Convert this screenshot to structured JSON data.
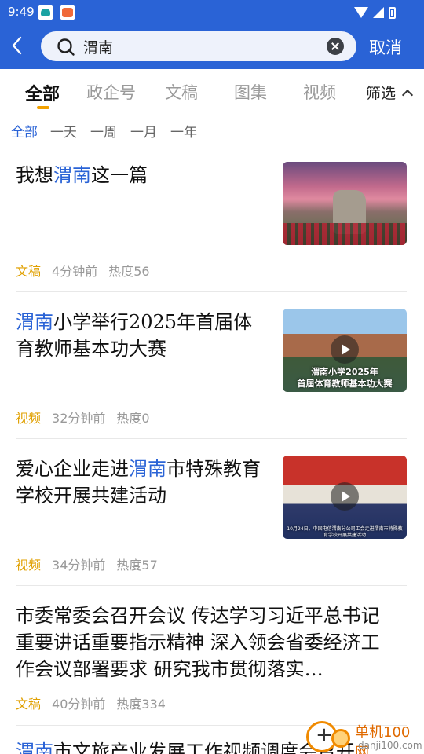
{
  "status_bar": {
    "time": "9:49"
  },
  "search": {
    "query": "渭南",
    "cancel_label": "取消"
  },
  "tabs": [
    {
      "label": "全部",
      "active": true
    },
    {
      "label": "政企号"
    },
    {
      "label": "文稿"
    },
    {
      "label": "图集"
    },
    {
      "label": "视频"
    }
  ],
  "filter": {
    "label": "筛选"
  },
  "time_filters": [
    {
      "label": "全部",
      "active": true
    },
    {
      "label": "一天"
    },
    {
      "label": "一周"
    },
    {
      "label": "一月"
    },
    {
      "label": "一年"
    }
  ],
  "results": [
    {
      "title_pre": "我想",
      "title_hl": "渭南",
      "title_post": "这一篇",
      "category": "文稿",
      "time": "4分钟前",
      "heat": "热度56",
      "thumbnail": "landscape-photo"
    },
    {
      "title_pre": "",
      "title_hl": "渭南",
      "title_post": "小学举行2025年首届体育教师基本功大赛",
      "category": "视频",
      "time": "32分钟前",
      "heat": "热度0",
      "thumbnail_caption_1": "渭南小学2025年",
      "thumbnail_caption_2": "首届体育教师基本功大赛"
    },
    {
      "title_pre": "爱心企业走进",
      "title_hl": "渭南",
      "title_post": "市特殊教育学校开展共建活动",
      "category": "视频",
      "time": "34分钟前",
      "heat": "热度57",
      "thumbnail_caption_1": "10月24日，中国电信渭南分公司工会走进渭南市特殊教育学校开展共建活动"
    },
    {
      "title_pre": "市委常委会召开会议 传达学习习近平总书记重要讲话重要指示精神 深入领会省委经济工作会议部署要求 研究我市贯彻落实…",
      "title_hl": "",
      "title_post": "",
      "category": "文稿",
      "time": "40分钟前",
      "heat": "热度334"
    },
    {
      "title_pre": "",
      "title_hl": "渭南",
      "title_post": "市文旅产业发展工作视频调度会召开"
    }
  ],
  "watermark": {
    "name": "单机100网",
    "url": "danji100.com"
  },
  "colors": {
    "header": "#2a63d6",
    "accent": "#2a63d6",
    "category": "#e0a000"
  }
}
